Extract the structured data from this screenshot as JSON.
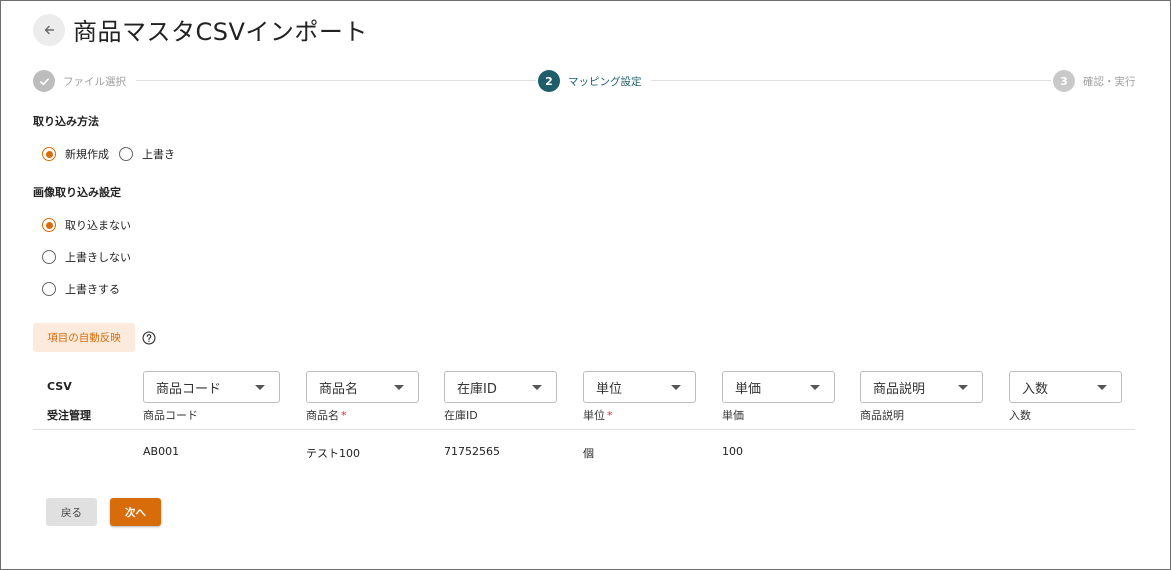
{
  "header": {
    "title": "商品マスタCSVインポート",
    "back_icon": "arrow-left-icon"
  },
  "stepper": {
    "steps": [
      {
        "label": "ファイル選択",
        "state": "done",
        "icon": "check-icon"
      },
      {
        "label": "マッピング設定",
        "number": "2",
        "state": "active"
      },
      {
        "label": "確認・実行",
        "number": "3",
        "state": "todo"
      }
    ]
  },
  "import_method": {
    "label": "取り込み方法",
    "options": [
      {
        "label": "新規作成",
        "checked": true
      },
      {
        "label": "上書き",
        "checked": false
      }
    ]
  },
  "image_setting": {
    "label": "画像取り込み設定",
    "options": [
      {
        "label": "取り込まない",
        "checked": true
      },
      {
        "label": "上書きしない",
        "checked": false
      },
      {
        "label": "上書きする",
        "checked": false
      }
    ]
  },
  "auto_button": {
    "label": "項目の自動反映",
    "help_icon": "question-circle-icon"
  },
  "mapping": {
    "csv_label": "CSV",
    "target_label": "受注管理",
    "columns": [
      {
        "selected": "商品コード",
        "field": "商品コード",
        "required": false,
        "value": "AB001"
      },
      {
        "selected": "商品名",
        "field": "商品名",
        "required": true,
        "value": "テスト100"
      },
      {
        "selected": "在庫ID",
        "field": "在庫ID",
        "required": false,
        "value": "71752565"
      },
      {
        "selected": "単位",
        "field": "単位",
        "required": true,
        "value": "個"
      },
      {
        "selected": "単価",
        "field": "単価",
        "required": false,
        "value": "100"
      },
      {
        "selected": "商品説明",
        "field": "商品説明",
        "required": false,
        "value": ""
      },
      {
        "selected": "入数",
        "field": "入数",
        "required": false,
        "value": ""
      }
    ],
    "required_mark": "*"
  },
  "footer": {
    "back_label": "戻る",
    "next_label": "次へ"
  },
  "colors": {
    "accent": "#d96c0a",
    "step_active": "#1d5e6a",
    "accent_light": "#fcebdd"
  }
}
